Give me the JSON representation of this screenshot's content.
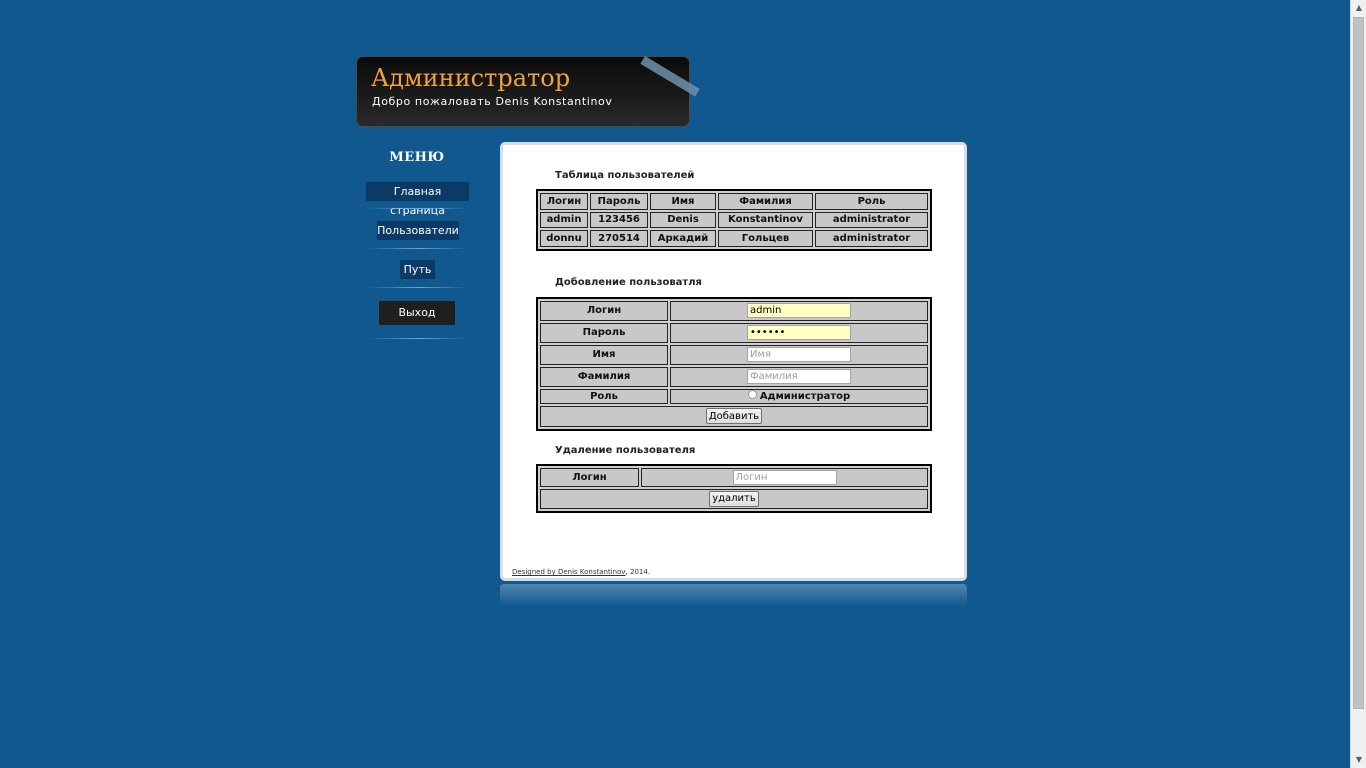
{
  "header": {
    "title": "Администратор",
    "welcome": "Добро пожаловать Denis Konstantinov"
  },
  "menu": {
    "title": "МЕНЮ",
    "items": [
      {
        "label": "Главная страница"
      },
      {
        "label": "Пользователи"
      },
      {
        "label": "Путь"
      }
    ],
    "logout": "Выход"
  },
  "users_table": {
    "title": "Таблица пользователей",
    "columns": [
      "Логин",
      "Пароль",
      "Имя",
      "Фамилия",
      "Роль"
    ],
    "rows": [
      [
        "admin",
        "123456",
        "Denis",
        "Konstantinov",
        "administrator"
      ],
      [
        "donnu",
        "270514",
        "Аркадий",
        "Гольцев",
        "administrator"
      ]
    ]
  },
  "add_user": {
    "title": "Добовление пользоватля",
    "login_label": "Логин",
    "login_value": "admin",
    "password_label": "Пароль",
    "password_value": "123456",
    "name_label": "Имя",
    "name_placeholder": "Имя",
    "surname_label": "Фамилия",
    "surname_placeholder": "Фамилия",
    "role_label": "Роль",
    "role_option": "Администратор",
    "submit": "Добавить"
  },
  "delete_user": {
    "title": "Удаление пользователя",
    "login_label": "Логин",
    "login_placeholder": "Логин",
    "submit": "удалить"
  },
  "footer": {
    "designed_by": "Designed by Denis Konstantinov",
    "year": ", 2014."
  },
  "colors": {
    "background": "#11588f",
    "title_accent": "#f0a23c",
    "menu_button": "#0c3a66",
    "filled_input": "#ffffc4"
  }
}
